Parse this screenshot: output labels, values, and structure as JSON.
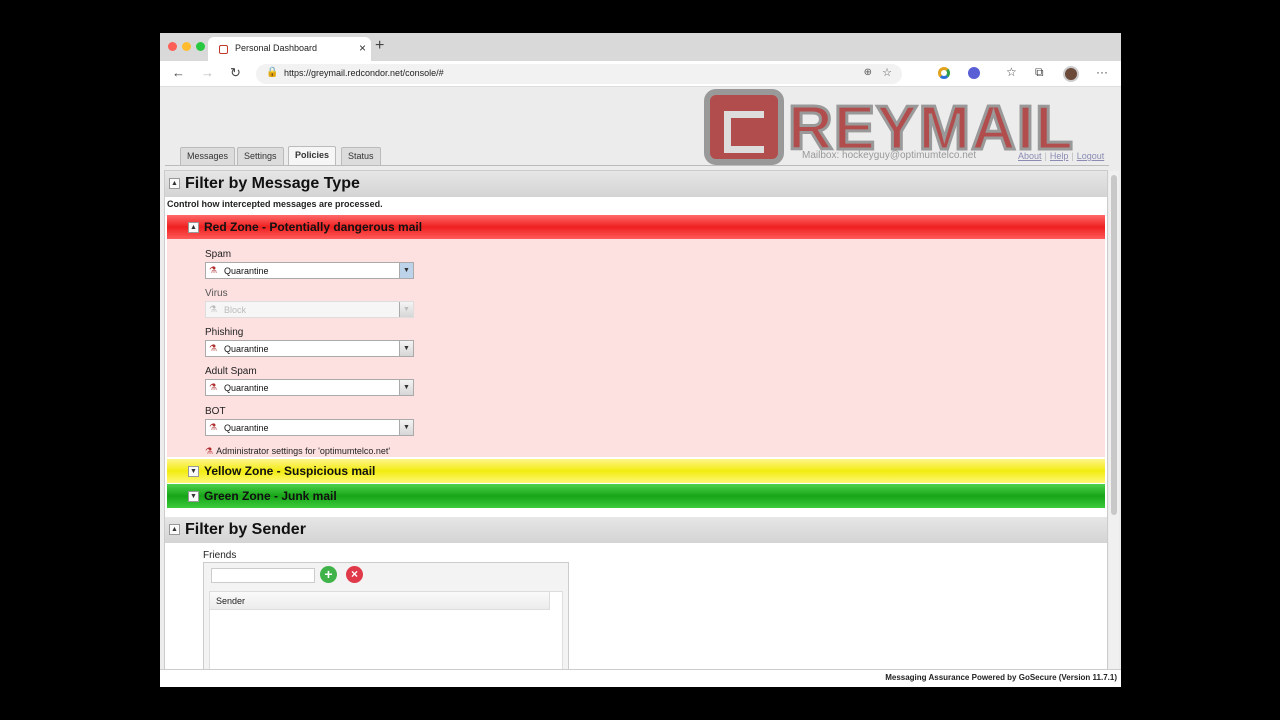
{
  "browser": {
    "tab_title": "Personal Dashboard",
    "tab_close": "×",
    "new_tab": "+",
    "url": "https://greymail.redcondor.net/console/#",
    "back": "←",
    "forward": "→",
    "reload": "↻",
    "lock": "🔒",
    "zoom": "⊕",
    "star": "☆",
    "favorites": "☆",
    "collections": "⧉",
    "menu": "···"
  },
  "header": {
    "logo_text": "REYMAIL",
    "mailbox": "Mailbox: hockeyguy@optimumtelco.net",
    "links": [
      "About",
      "Help",
      "Logout"
    ]
  },
  "nav": {
    "tabs": [
      "Messages",
      "Settings",
      "Policies",
      "Status"
    ],
    "active": "Policies"
  },
  "filter_type": {
    "title": "Filter by Message Type",
    "subtitle": "Control how intercepted messages are processed.",
    "collapse_icon": "▲",
    "red_zone": {
      "title": "Red Zone - Potentially dangerous mail",
      "fields": [
        {
          "label": "Spam",
          "value": "Quarantine"
        },
        {
          "label": "Virus",
          "value": "Block"
        },
        {
          "label": "Phishing",
          "value": "Quarantine"
        },
        {
          "label": "Adult Spam",
          "value": "Quarantine"
        },
        {
          "label": "BOT",
          "value": "Quarantine"
        }
      ],
      "admin_note": "Administrator settings for 'optimumtelco.net'"
    },
    "yellow_zone": {
      "title": "Yellow Zone - Suspicious mail"
    },
    "green_zone": {
      "title": "Green Zone - Junk mail"
    },
    "expand_icon": "▼",
    "dropdown_arrow": "▼"
  },
  "filter_sender": {
    "title": "Filter by Sender",
    "friends_label": "Friends",
    "friend_input": "",
    "add_icon": "+",
    "remove_icon": "×",
    "column_header": "Sender"
  },
  "footer": {
    "text": "Messaging Assurance Powered by GoSecure  (Version 11.7.1)"
  },
  "colors": {
    "red_zone": "#ef2020",
    "yellow_zone": "#f2ec10",
    "green_zone": "#18a518",
    "logo": "#b24d4d"
  }
}
